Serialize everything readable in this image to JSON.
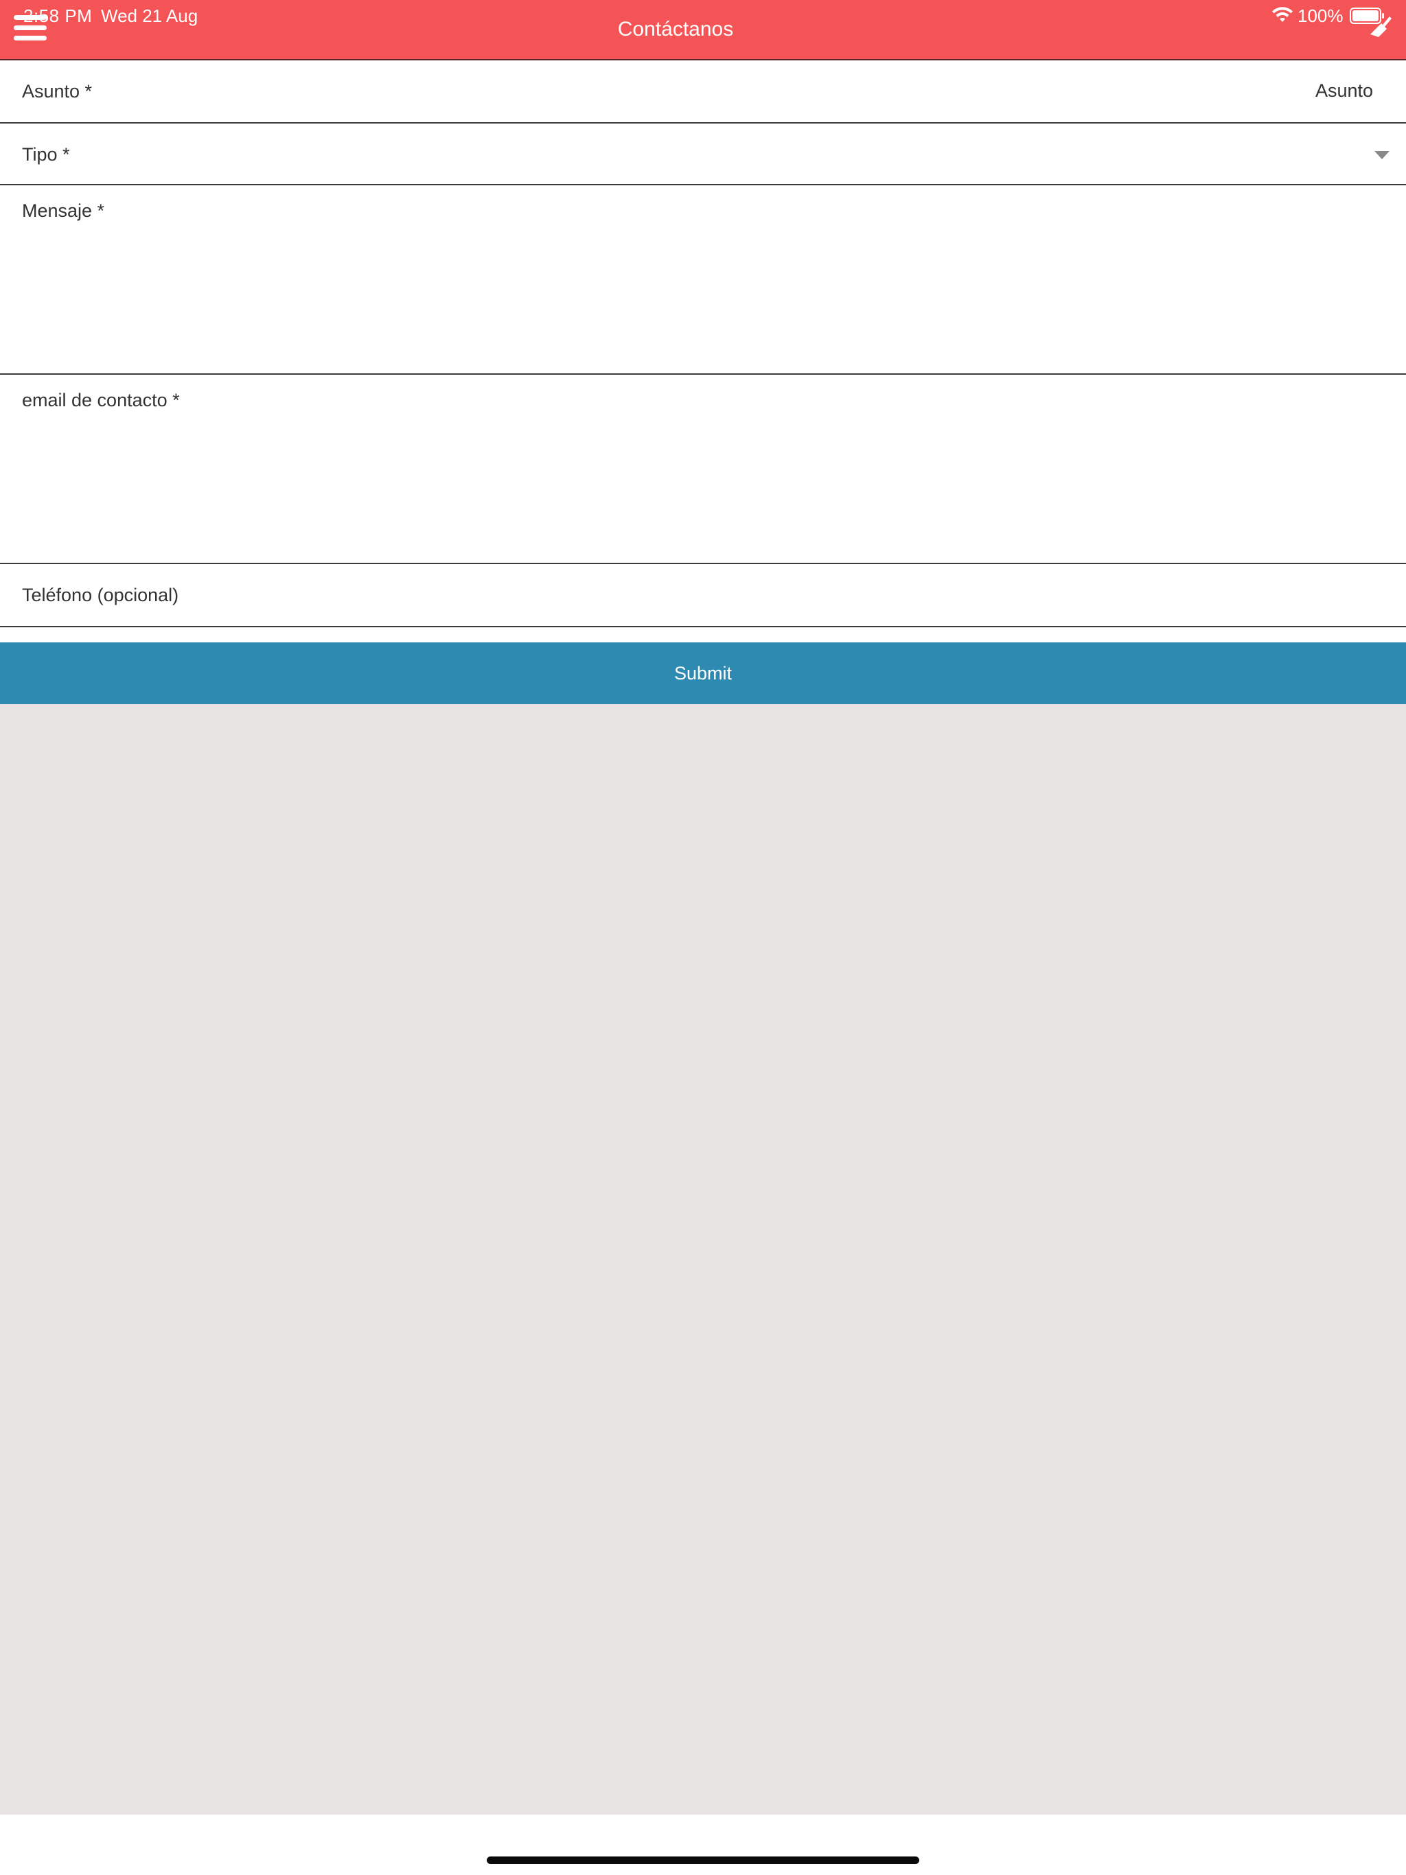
{
  "status_bar": {
    "time": "2:58 PM",
    "date": "Wed 21 Aug",
    "battery": "100%"
  },
  "header": {
    "title": "Contáctanos",
    "background_color": "#f45455"
  },
  "form": {
    "asunto": {
      "label": "Asunto *",
      "placeholder": "Asunto"
    },
    "tipo": {
      "label": "Tipo *"
    },
    "mensaje": {
      "label": "Mensaje *"
    },
    "email": {
      "label": "email de contacto *"
    },
    "telefono": {
      "label": "Teléfono (opcional)"
    },
    "submit_label": "Submit",
    "submit_color": "#2e8ab0"
  },
  "icons": {
    "menu": "hamburger-menu-icon",
    "wifi": "wifi-icon",
    "battery": "battery-icon",
    "clean": "broom-icon",
    "dropdown": "chevron-down-icon"
  }
}
